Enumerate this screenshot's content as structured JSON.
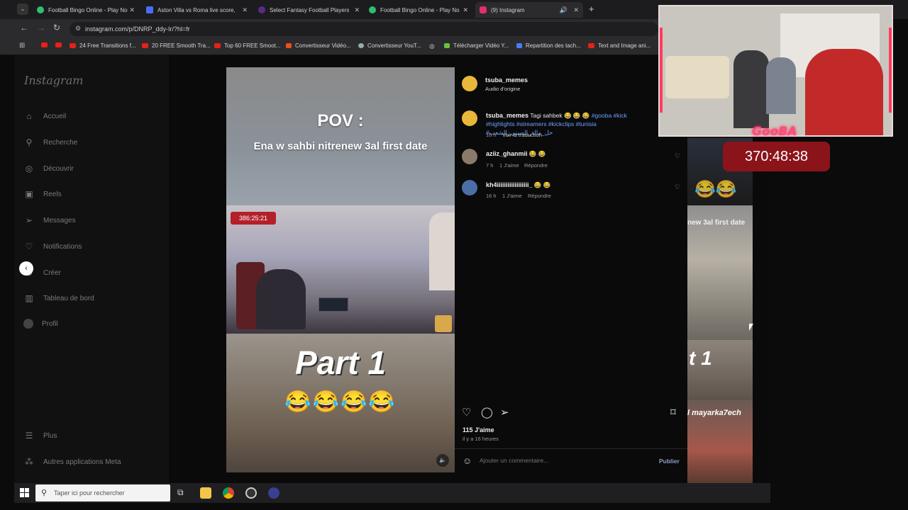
{
  "tabs": [
    {
      "label": "Football Bingo Online - Play No",
      "color": "#2fbf71"
    },
    {
      "label": "Aston Villa vs Roma live score, l",
      "color": "#4a6cf7"
    },
    {
      "label": "Select Fantasy Football Players",
      "color": "#5b2a86"
    },
    {
      "label": "Football Bingo Online - Play No",
      "color": "#2fbf71"
    },
    {
      "label": "(9) Instagram",
      "color": "#e1306c"
    }
  ],
  "url": "instagram.com/p/DNRP_ddy-Ir/?hl=fr",
  "bookmarks": [
    "24 Free Transitions f...",
    "20 FREE Smooth Tra...",
    "Top 60 FREE Smoot...",
    "Convertisseur Vidéo...",
    "Convertisseur YouT...",
    "Télécharger Vidéo Y...",
    "Repartition des tach...",
    "Text and Image ani..."
  ],
  "sidebar": {
    "logo": "Instagram",
    "items": [
      {
        "label": "Accueil",
        "icon": "home-icon",
        "glyph": "⌂"
      },
      {
        "label": "Recherche",
        "icon": "search-icon",
        "glyph": "⚲"
      },
      {
        "label": "Découvrir",
        "icon": "compass-icon",
        "glyph": "◎"
      },
      {
        "label": "Reels",
        "icon": "reels-icon",
        "glyph": "▣"
      },
      {
        "label": "Messages",
        "icon": "messages-icon",
        "glyph": "➢"
      },
      {
        "label": "Notifications",
        "icon": "heart-icon",
        "glyph": "♡"
      },
      {
        "label": "Créer",
        "icon": "create-icon",
        "glyph": "⊕"
      },
      {
        "label": "Tableau de bord",
        "icon": "dashboard-icon",
        "glyph": "▥"
      },
      {
        "label": "Profil",
        "icon": "profile-icon",
        "glyph": "●"
      }
    ],
    "more": "Plus",
    "meta": "Autres applications Meta"
  },
  "reel": {
    "pov": "POV :",
    "subtitle": "Ena w sahbi nitrenew 3al first date",
    "timer": "386:25:21",
    "part": "Part 1",
    "emojis": "😂😂😂😂"
  },
  "post": {
    "author": "tsuba_memes",
    "audio": "Audio d'origine",
    "caption_user": "tsuba_memes",
    "caption_text": "Tagi sahbek 😂 😂 😂 ",
    "caption_tags": "#gooba #kick #highlights #streamers #kickclips #tunisia #حل_مالة_الصيني_الشعب",
    "caption_time": "16 h",
    "translate": "Voir la traduction",
    "comments": [
      {
        "user": "aziiz_ghanmii",
        "text": "😂 😂",
        "time": "7 h",
        "likes": "1 J'aime",
        "reply": "Répondre"
      },
      {
        "user": "kh4iiiiiiiiiiiiiiiiii_",
        "text": "😂 😂",
        "time": "16 h",
        "likes": "1 J'aime",
        "reply": "Répondre"
      }
    ],
    "likes": "115 J'aime",
    "posted": "il y a 16 heures",
    "comment_placeholder": "Ajouter un commentaire...",
    "publish": "Publier"
  },
  "side_tiles": [
    "new 3al first date",
    "t 1",
    "l mayarka7ech"
  ],
  "overlay": {
    "brand": "GooBA",
    "timer": "370:48:38"
  },
  "taskbar": {
    "search_placeholder": "Taper ici pour rechercher"
  }
}
